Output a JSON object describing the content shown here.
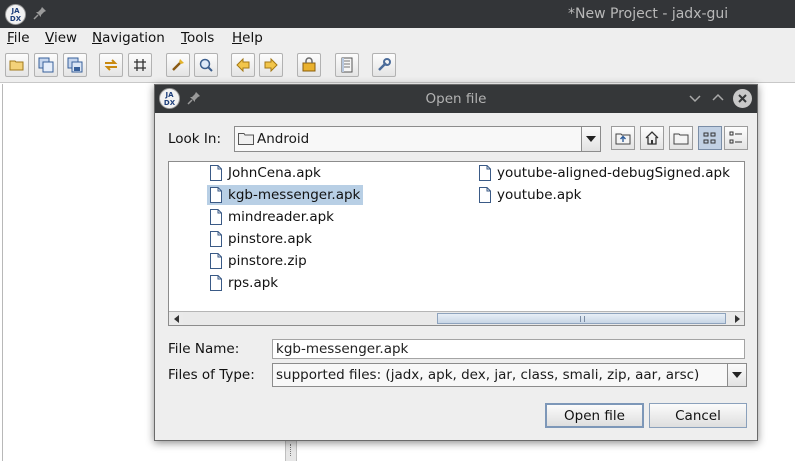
{
  "window": {
    "title": "*New Project - jadx-gui",
    "logo_text": "JA\nDX"
  },
  "menubar": {
    "items": [
      "File",
      "View",
      "Navigation",
      "Tools",
      "Help"
    ]
  },
  "toolbar": {
    "icons": [
      "open-file-icon",
      "add-files-icon",
      "save-all-icon",
      "sync-icon",
      "flatten-packages-icon",
      "text-search-icon",
      "class-search-icon",
      "back-icon",
      "forward-icon",
      "deobfuscation-icon",
      "log-viewer-icon",
      "preferences-icon"
    ]
  },
  "dialog": {
    "title": "Open file",
    "look_in_label": "Look In:",
    "look_in_value": "Android",
    "files_column1": [
      "JohnCena.apk",
      "kgb-messenger.apk",
      "mindreader.apk",
      "pinstore.apk",
      "pinstore.zip",
      "rps.apk"
    ],
    "files_column2": [
      "youtube-aligned-debugSigned.apk",
      "youtube.apk"
    ],
    "selected_file": "kgb-messenger.apk",
    "file_name_label": "File Name:",
    "file_name_value": "kgb-messenger.apk",
    "files_of_type_label": "Files of Type:",
    "files_of_type_value": "supported files: (jadx, apk, dex, jar, class, smali, zip, aar, arsc)",
    "open_button": "Open file",
    "cancel_button": "Cancel"
  },
  "colors": {
    "titlebar": "#333538",
    "selection": "#b8cfe5",
    "toggle_active": "#c2d1e4"
  }
}
